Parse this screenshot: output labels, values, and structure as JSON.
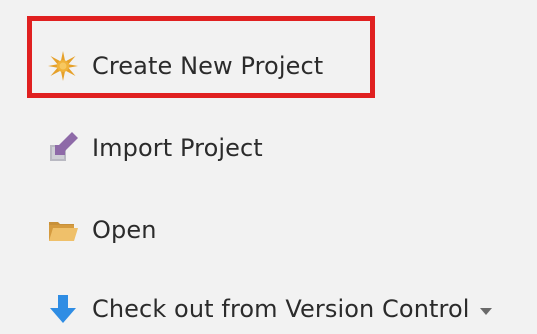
{
  "actions": {
    "create_new_project": {
      "label": "Create New Project",
      "icon": "new-project-star-icon"
    },
    "import_project": {
      "label": "Import Project",
      "icon": "import-arrow-icon"
    },
    "open": {
      "label": "Open",
      "icon": "folder-open-icon"
    },
    "checkout_vcs": {
      "label": "Check out from Version Control",
      "icon": "download-arrow-icon",
      "has_dropdown": true
    }
  },
  "colors": {
    "background": "#f2f2f2",
    "text": "#2b2b2b",
    "highlight": "#e02020",
    "star": "#e6a12a",
    "import_icon": "#8e6aa8",
    "folder": "#e0a94a",
    "download_arrow": "#2f8de4"
  }
}
